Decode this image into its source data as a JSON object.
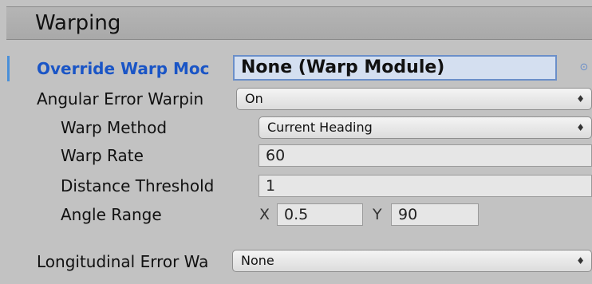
{
  "section": {
    "title": "Warping"
  },
  "override_warp_module": {
    "label": "Override Warp Moc",
    "value": "None (Warp Module)",
    "picker_icon": "object-picker-icon"
  },
  "angular_error_warping": {
    "label": "Angular Error Warpin",
    "value": "On"
  },
  "warp_method": {
    "label": "Warp Method",
    "value": "Current Heading"
  },
  "warp_rate": {
    "label": "Warp Rate",
    "value": "60"
  },
  "distance_threshold": {
    "label": "Distance Threshold",
    "value": "1"
  },
  "angle_range": {
    "label": "Angle Range",
    "x_label": "X",
    "x_value": "0.5",
    "y_label": "Y",
    "y_value": "90"
  },
  "longitudinal_error_warping": {
    "label": "Longitudinal Error Wa",
    "value": "None"
  },
  "colors": {
    "background": "#c2c2c2",
    "header": "#adadad",
    "accent": "#4a90d9",
    "override_label": "#1a55c6"
  }
}
